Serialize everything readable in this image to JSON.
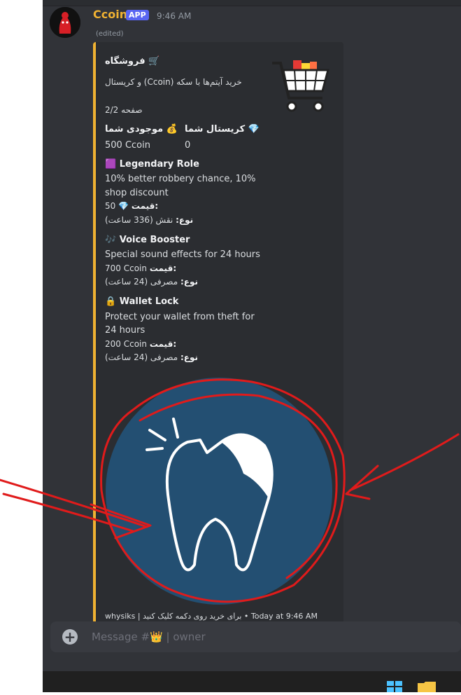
{
  "message": {
    "author": "Ccoin",
    "badge": "APP",
    "time": "9:46 AM",
    "edited": "(edited)"
  },
  "embed": {
    "title": "🛒 فروشگاه",
    "description": "خرید آیتم‌ها با سکه (Ccoin) و کریستال",
    "page": "صفحه 2/2",
    "balances": [
      {
        "name": "💰 موجودی شما",
        "value": "500 Ccoin"
      },
      {
        "name": "💎 کریستال شما",
        "value": "0"
      }
    ],
    "items": [
      {
        "emoji": "🟪",
        "name": "Legendary Role",
        "desc1": "10% better robbery chance, 10%",
        "desc2": "shop discount",
        "price_label": "قیمت:",
        "price": "50 💎",
        "type_label": "نوع:",
        "type": "نقش (336 ساعت)"
      },
      {
        "emoji": "🎶",
        "name": "Voice Booster",
        "desc1": "Special sound effects for 24 hours",
        "desc2": "",
        "price_label": "قیمت:",
        "price": "700 Ccoin",
        "type_label": "نوع:",
        "type": "مصرفی (24 ساعت)"
      },
      {
        "emoji": "🔒",
        "name": "Wallet Lock",
        "desc1": "Protect your wallet from theft for",
        "desc2": "24 hours",
        "price_label": "قیمت:",
        "price": "200 Ccoin",
        "type_label": "نوع:",
        "type": "مصرفی (24 ساعت)"
      }
    ],
    "footer": "whysiks | برای خرید روی دکمه کلیک کنید • Today at 9:46 AM"
  },
  "composer": {
    "placeholder": "Message #👑 | owner"
  },
  "colors": {
    "accent": "#f0b232",
    "badge": "#5865f2",
    "image_bg": "#234f72",
    "annotation": "#e01b1b"
  },
  "icons": [
    "cart-icon",
    "tooth-icon",
    "add-icon",
    "windows-icon",
    "folder-icon"
  ]
}
